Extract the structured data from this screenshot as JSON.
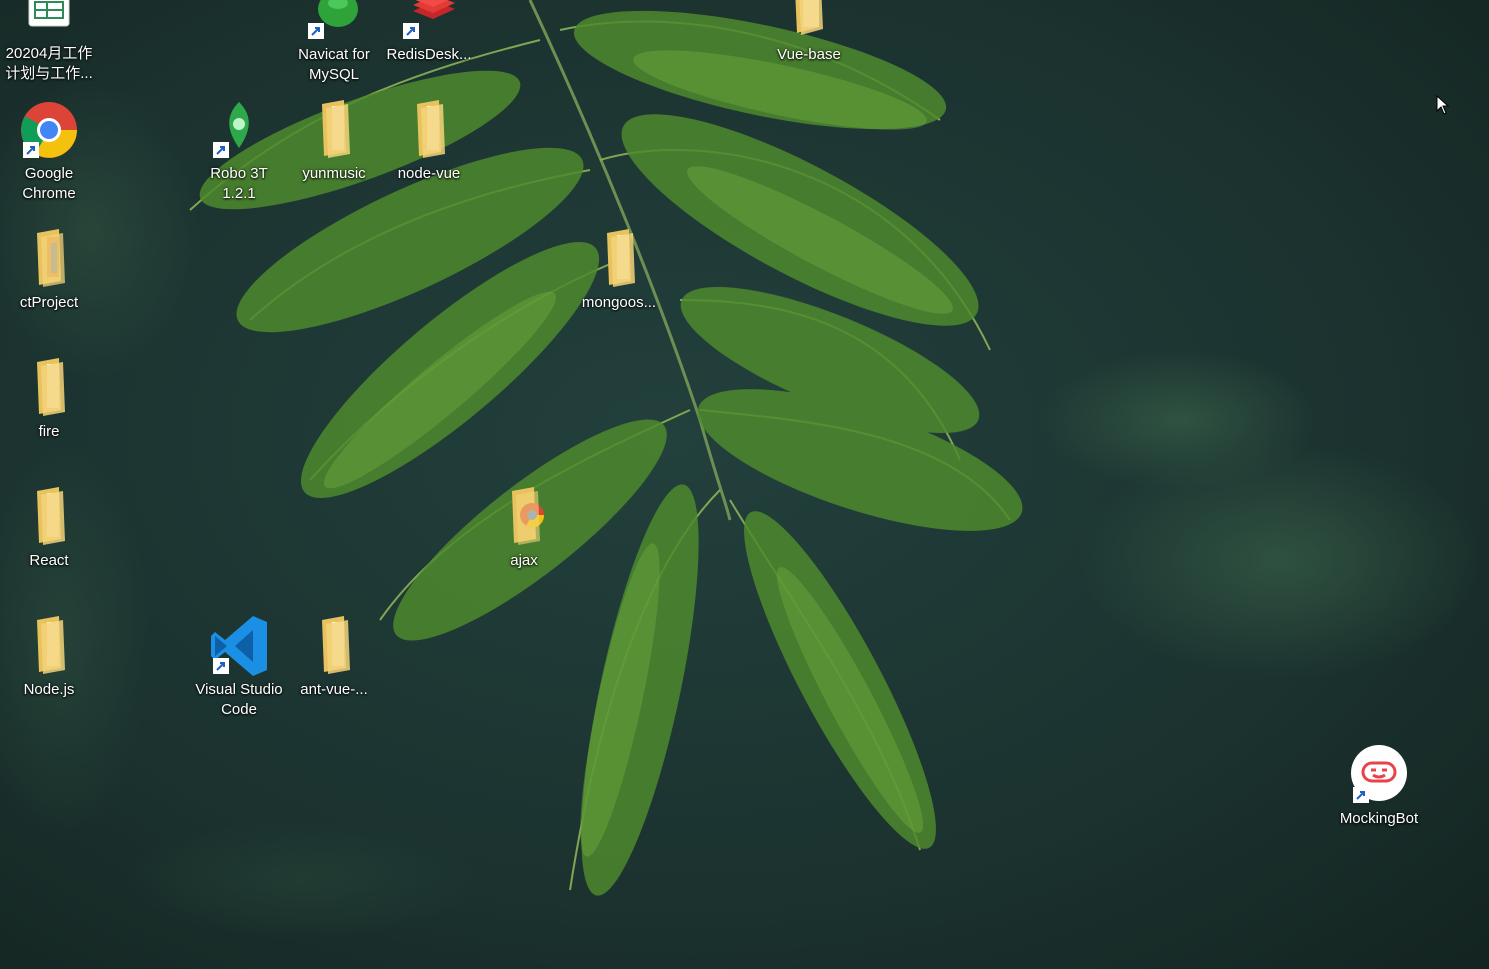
{
  "desktop": {
    "icons": [
      {
        "label": "20204月工作计划与工作...",
        "icon": "spreadsheet-icon"
      },
      {
        "label": "Navicat for MySQL",
        "icon": "navicat-icon"
      },
      {
        "label": "RedisDesk...",
        "icon": "redis-desktop-icon"
      },
      {
        "label": "Vue-base",
        "icon": "folder-icon"
      },
      {
        "label": "Google Chrome",
        "icon": "chrome-icon"
      },
      {
        "label": "Robo 3T 1.2.1",
        "icon": "robo3t-icon"
      },
      {
        "label": "yunmusic",
        "icon": "folder-icon"
      },
      {
        "label": "node-vue",
        "icon": "folder-icon"
      },
      {
        "label": "ctProject",
        "icon": "folder-icon"
      },
      {
        "label": "mongoos...",
        "icon": "folder-icon"
      },
      {
        "label": "fire",
        "icon": "folder-icon"
      },
      {
        "label": "React",
        "icon": "folder-icon"
      },
      {
        "label": "ajax",
        "icon": "folder-icon"
      },
      {
        "label": "Node.js",
        "icon": "folder-icon"
      },
      {
        "label": "Visual Studio Code",
        "icon": "vscode-icon"
      },
      {
        "label": "ant-vue-...",
        "icon": "folder-icon"
      },
      {
        "label": "MockingBot",
        "icon": "mockingbot-icon"
      }
    ]
  },
  "colors": {
    "background": "#1d3431",
    "leaf": "#4f8a2e",
    "folder": "#f3d37a"
  }
}
